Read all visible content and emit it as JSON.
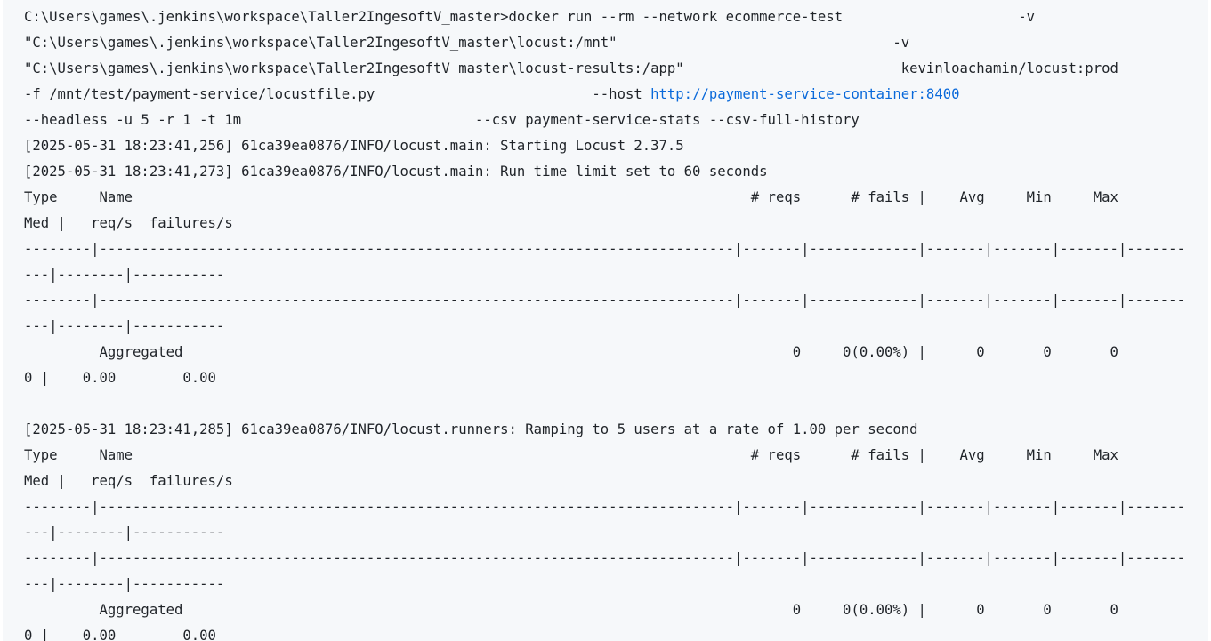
{
  "terminal": {
    "lines": [
      {
        "kind": "text",
        "text": "C:\\Users\\games\\.jenkins\\workspace\\Taller2IngesoftV_master>docker run --rm --network ecommerce-test                     -v"
      },
      {
        "kind": "text",
        "text": "\"C:\\Users\\games\\.jenkins\\workspace\\Taller2IngesoftV_master\\locust:/mnt\"                                 -v"
      },
      {
        "kind": "text",
        "text": "\"C:\\Users\\games\\.jenkins\\workspace\\Taller2IngesoftV_master\\locust-results:/app\"                          kevinloachamin/locust:prod"
      },
      {
        "kind": "link",
        "before": "-f /mnt/test/payment-service/locustfile.py                          --host ",
        "link": "http://payment-service-container:8400",
        "after": ""
      },
      {
        "kind": "text",
        "text": "--headless -u 5 -r 1 -t 1m                            --csv payment-service-stats --csv-full-history"
      },
      {
        "kind": "text",
        "text": "[2025-05-31 18:23:41,256] 61ca39ea0876/INFO/locust.main: Starting Locust 2.37.5"
      },
      {
        "kind": "text",
        "text": "[2025-05-31 18:23:41,273] 61ca39ea0876/INFO/locust.main: Run time limit set to 60 seconds"
      },
      {
        "kind": "text",
        "text": "Type     Name                                                                          # reqs      # fails |    Avg     Min     Max"
      },
      {
        "kind": "text",
        "text": "Med |   req/s  failures/s"
      },
      {
        "kind": "text",
        "text": "--------|----------------------------------------------------------------------------|-------|-------------|-------|-------|-------|-------"
      },
      {
        "kind": "text",
        "text": "---|--------|-----------"
      },
      {
        "kind": "text",
        "text": "--------|----------------------------------------------------------------------------|-------|-------------|-------|-------|-------|-------"
      },
      {
        "kind": "text",
        "text": "---|--------|-----------"
      },
      {
        "kind": "text",
        "text": "         Aggregated                                                                         0     0(0.00%) |      0       0       0"
      },
      {
        "kind": "text",
        "text": "0 |    0.00        0.00"
      },
      {
        "kind": "text",
        "text": ""
      },
      {
        "kind": "text",
        "text": "[2025-05-31 18:23:41,285] 61ca39ea0876/INFO/locust.runners: Ramping to 5 users at a rate of 1.00 per second"
      },
      {
        "kind": "text",
        "text": "Type     Name                                                                          # reqs      # fails |    Avg     Min     Max"
      },
      {
        "kind": "text",
        "text": "Med |   req/s  failures/s"
      },
      {
        "kind": "text",
        "text": "--------|----------------------------------------------------------------------------|-------|-------------|-------|-------|-------|-------"
      },
      {
        "kind": "text",
        "text": "---|--------|-----------"
      },
      {
        "kind": "text",
        "text": "--------|----------------------------------------------------------------------------|-------|-------------|-------|-------|-------|-------"
      },
      {
        "kind": "text",
        "text": "---|--------|-----------"
      },
      {
        "kind": "text",
        "text": "         Aggregated                                                                         0     0(0.00%) |      0       0       0"
      },
      {
        "kind": "text",
        "text": "0 |    0.00        0.00"
      }
    ]
  },
  "colors": {
    "background": "#f6f8fa",
    "text": "#1f2328",
    "link": "#0969da"
  }
}
